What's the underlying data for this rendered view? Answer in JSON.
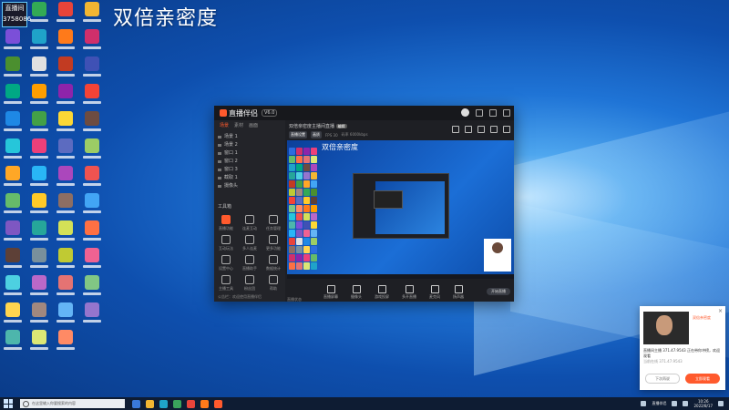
{
  "headline": "双倍亲密度",
  "live_badge": {
    "line1": "直播间",
    "line2": "3758086"
  },
  "desktop_icon_colors": [
    "#2d6cdf",
    "#33aa55",
    "#e8443a",
    "#f2b632",
    "#7b4fd8",
    "#1fa3c9",
    "#ff7a1a",
    "#d02f6b",
    "#4b8f2f",
    "#e0e0e0",
    "#c23b22",
    "#3f51b5",
    "#00a884",
    "#ff9e00",
    "#8e24aa",
    "#f44336",
    "#1e88e5",
    "#43a047",
    "#fdd835",
    "#6d4c41",
    "#26c6da",
    "#ec407a",
    "#5c6bc0",
    "#9ccc65",
    "#ffa726",
    "#29b6f6",
    "#ab47bc",
    "#ef5350",
    "#66bb6a",
    "#ffca28",
    "#8d6e63",
    "#42a5f5",
    "#7e57c2",
    "#26a69a",
    "#d4e157",
    "#ff7043",
    "#5d4037",
    "#78909c",
    "#c0ca33",
    "#f06292",
    "#4dd0e1",
    "#ba68c8",
    "#e57373",
    "#81c784",
    "#ffd54f",
    "#a1887f",
    "#64b5f6",
    "#9575cd",
    "#4db6ac",
    "#dce775",
    "#ff8a65"
  ],
  "app": {
    "name": "直播伴侣",
    "version": "V6.0",
    "left_tabs": [
      "场景",
      "素材",
      "画面"
    ],
    "scenes": [
      "场景 1",
      "场景 2",
      "窗口 1",
      "窗口 2",
      "窗口 3",
      "截取 1",
      "摄像头"
    ],
    "tools_header": "工具箱",
    "tools": [
      {
        "label": "直播功能",
        "active": true
      },
      {
        "label": "连麦互动",
        "active": false
      },
      {
        "label": "任务管理",
        "active": false
      },
      {
        "label": "互动玩法",
        "active": false
      },
      {
        "label": "多人连麦",
        "active": false
      },
      {
        "label": "更多功能",
        "active": false
      },
      {
        "label": "设置中心",
        "active": false
      },
      {
        "label": "直播助手",
        "active": false
      },
      {
        "label": "数据统计",
        "active": false
      },
      {
        "label": "主播工具",
        "active": false
      },
      {
        "label": "粉丝团",
        "active": false
      },
      {
        "label": "帮助",
        "active": false
      }
    ],
    "left_footer": "公告栏：欢迎使用直播伴侣",
    "stream_title": "双倍亲密度主播间直播",
    "stream_tag": "编辑",
    "sub_buttons": [
      "直播设置",
      "画质"
    ],
    "sub_stats": [
      "FPS 30",
      "码率 6000kbps"
    ],
    "preview_headline": "双倍亲密度",
    "controls": [
      "直播屏幕",
      "摄像头",
      "游戏投屏",
      "多开直播",
      "麦克风",
      "扬声器"
    ],
    "live_button": "开始直播",
    "main_footer": "直播状态"
  },
  "notification": {
    "title": "双倍亲密度",
    "text": "直播间主播 371.47.9543 正在带你冲榜，欢迎观看",
    "subtext": "当前在线 371.47.9543",
    "cancel": "下次再说",
    "ok": "立即观看"
  },
  "taskbar": {
    "search_placeholder": "在这里输入你要搜索的内容",
    "tray_text": "直播伴侣",
    "time": "10:26",
    "date": "2022/8/17"
  },
  "taskbar_app_colors": [
    "#3a79d9",
    "#f2b632",
    "#1fa3c9",
    "#3aa35c",
    "#e8443a",
    "#ff7a1a",
    "#ff5a2d"
  ]
}
